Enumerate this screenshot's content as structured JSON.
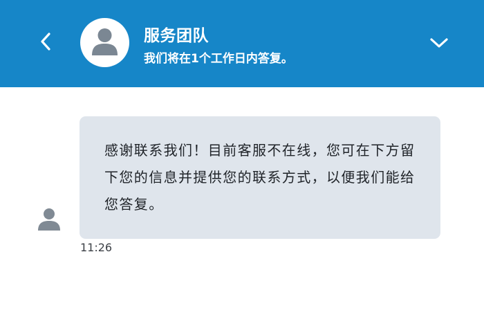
{
  "header": {
    "title": "服务团队",
    "subtitle": "我们将在1个工作日内答复。",
    "back_icon": "chevron-left-icon",
    "collapse_icon": "chevron-down-icon",
    "avatar_icon": "person-icon",
    "background_color": "#1686c8"
  },
  "conversation": {
    "messages": [
      {
        "text": "感谢联系我们！目前客服不在线，您可在下方留下您的信息并提供您的联系方式，以便我们能给您答复。",
        "time": "11:26",
        "avatar_icon": "person-icon",
        "bubble_color": "#dfe5ec"
      }
    ]
  }
}
